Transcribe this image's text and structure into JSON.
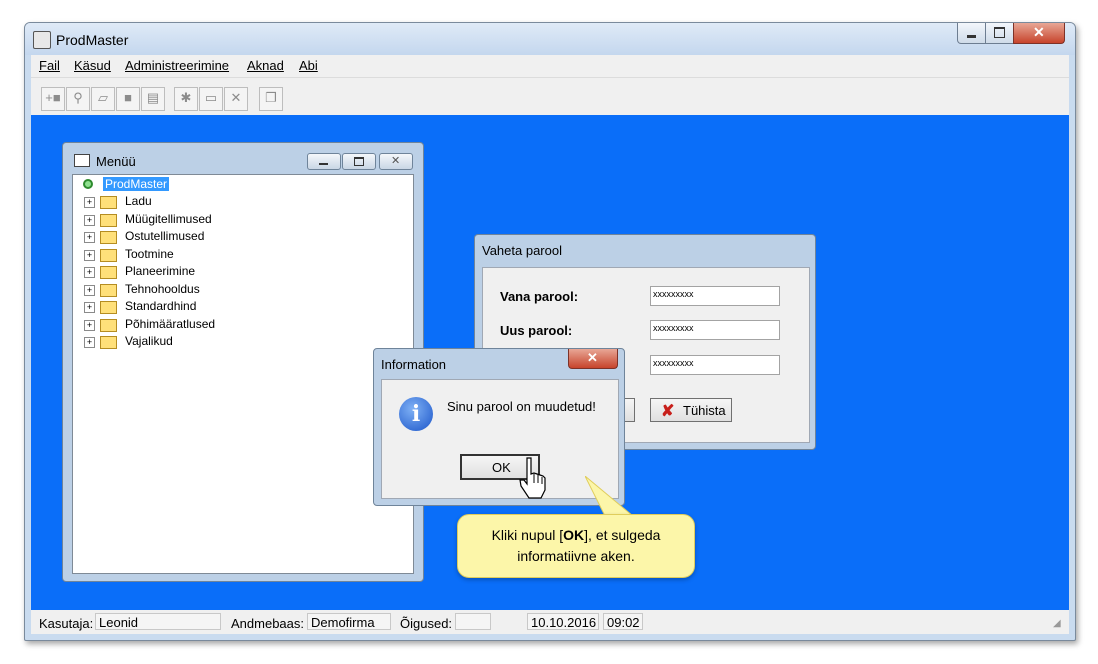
{
  "window": {
    "title": "ProdMaster"
  },
  "menubar": [
    "Fail",
    "Käsud",
    "Administreerimine",
    "Aknad",
    "Abi"
  ],
  "toolbar_icons": [
    "add-icon",
    "binoculars-icon",
    "eraser-icon",
    "stop-icon",
    "document-icon",
    "new-folder-icon",
    "folder-icon",
    "delete-icon",
    "windows-icon"
  ],
  "menu_window": {
    "title": "Menüü",
    "root": "ProdMaster",
    "items": [
      "Ladu",
      "Müügitellimused",
      "Ostutellimused",
      "Tootmine",
      "Planeerimine",
      "Tehnohooldus",
      "Standardhind",
      "Põhimääratlused",
      "Vajalikud"
    ]
  },
  "password_dialog": {
    "title": "Vaheta parool",
    "old_label": "Vana parool:",
    "new_label": "Uus parool:",
    "old_value": "xxxxxxxxx",
    "new_value": "xxxxxxxxx",
    "confirm_value": "xxxxxxxxx",
    "cancel_label": "Tühista"
  },
  "info_dialog": {
    "title": "Information",
    "message": "Sinu parool on muudetud!",
    "ok_label": "OK"
  },
  "callout": {
    "line1_before": "Kliki nupul [",
    "line1_bold": "OK",
    "line1_after": "], et sulgeda",
    "line2": "informatiivne aken."
  },
  "statusbar": {
    "user_label": "Kasutaja:",
    "user_value": "Leonid",
    "db_label": "Andmebaas:",
    "db_value": "Demofirma",
    "rights_label": "Õigused:",
    "rights_value": "",
    "date": "10.10.2016",
    "time": "09:02"
  },
  "colors": {
    "desktop": "#0a6ef9",
    "callout": "#fcf6a9"
  }
}
